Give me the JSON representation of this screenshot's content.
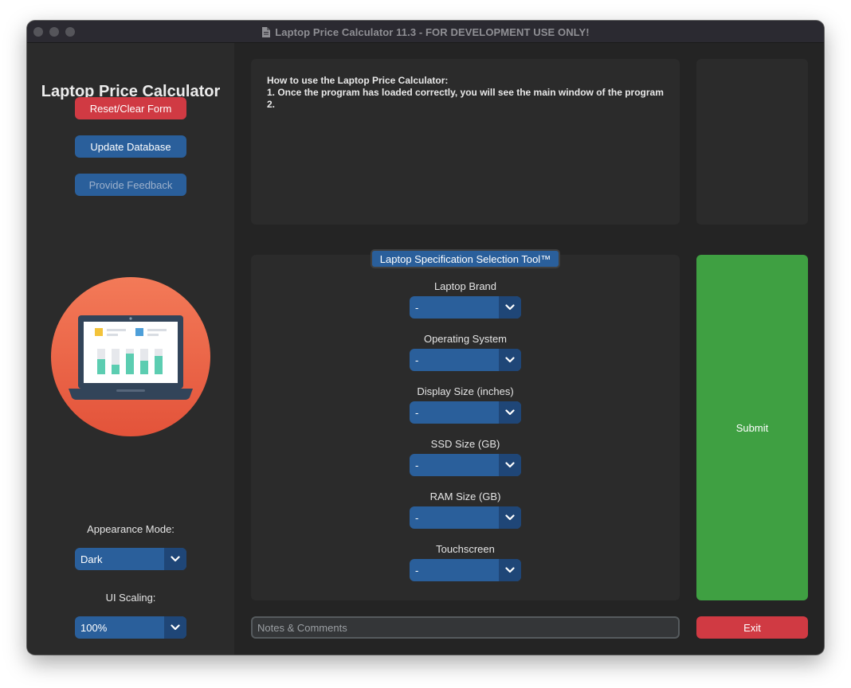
{
  "window": {
    "title": "Laptop Price Calculator 11.3 - FOR DEVELOPMENT USE ONLY!"
  },
  "sidebar": {
    "app_title": "Laptop Price Calculator",
    "buttons": {
      "reset": "Reset/Clear Form",
      "update": "Update Database",
      "feedback": "Provide Feedback"
    },
    "appearance_label": "Appearance Mode:",
    "appearance_value": "Dark",
    "scaling_label": "UI Scaling:",
    "scaling_value": "100%"
  },
  "instructions": {
    "heading": "How to use the Laptop Price Calculator:",
    "lines": [
      "1. Once the program has loaded correctly, you will see the main window of the program",
      "2."
    ]
  },
  "spec_tool": {
    "title": "Laptop Specification Selection Tool™",
    "fields": [
      {
        "label": "Laptop Brand",
        "value": "-"
      },
      {
        "label": "Operating System",
        "value": "-"
      },
      {
        "label": "Display Size (inches)",
        "value": "-"
      },
      {
        "label": "SSD Size (GB)",
        "value": "-"
      },
      {
        "label": "RAM Size (GB)",
        "value": "-"
      },
      {
        "label": "Touchscreen",
        "value": "-"
      }
    ]
  },
  "actions": {
    "submit": "Submit",
    "exit": "Exit"
  },
  "notes": {
    "placeholder": "Notes & Comments"
  },
  "icons": {
    "document": "document-icon",
    "hero": "laptop-dashboard-illustration",
    "dropdown": "chevron-down-icon"
  },
  "colors": {
    "window_bg": "#242424",
    "panel_bg": "#2b2b2b",
    "primary_button": "#2a5f9b",
    "reset_button": "#d03a43",
    "submit_button": "#3fa042",
    "exit_button": "#d03a43",
    "hero_circle": "#ee6849"
  }
}
